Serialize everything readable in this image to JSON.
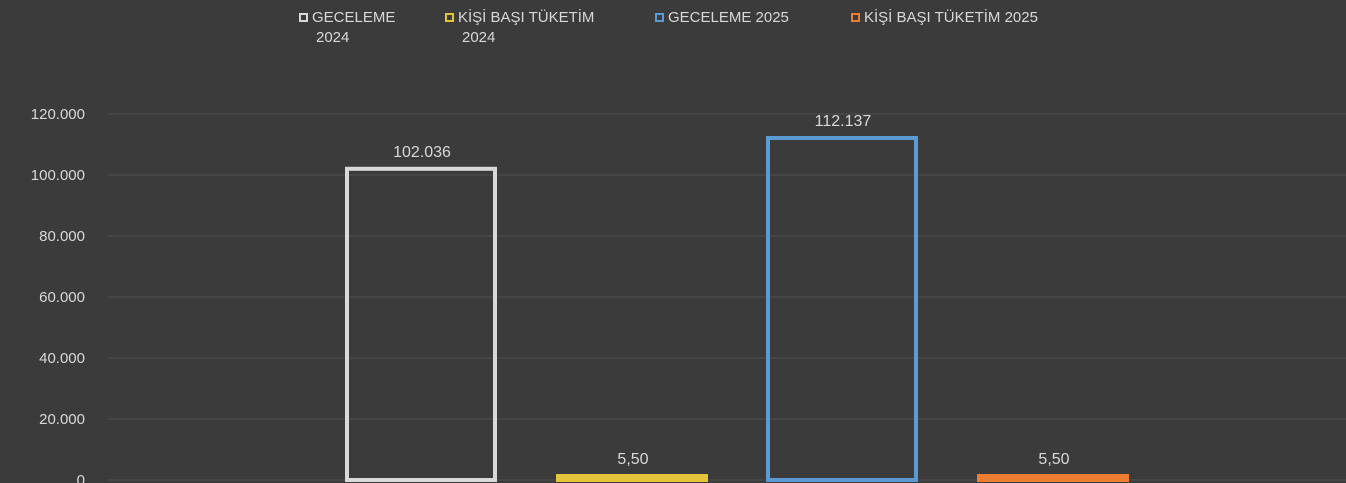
{
  "chart_data": {
    "type": "bar",
    "title": "",
    "xlabel": "",
    "ylabel": "",
    "ylim": [
      0,
      120000
    ],
    "y_ticks": [
      0,
      20000,
      40000,
      60000,
      80000,
      100000,
      120000
    ],
    "y_tick_labels": [
      "0",
      "20.000",
      "40.000",
      "60.000",
      "80.000",
      "100.000",
      "120.000"
    ],
    "grid": true,
    "legend_position": "top",
    "series": [
      {
        "name": "GECELEME 2024",
        "value": 102036,
        "label": "102.036",
        "color": "#d9d9d9"
      },
      {
        "name": "KİŞİ BAŞI TÜKETİM 2024",
        "value": 5.5,
        "label": "5,50",
        "color": "#e5c33a"
      },
      {
        "name": "GECELEME 2025",
        "value": 112137,
        "label": "112.137",
        "color": "#5b9bd5"
      },
      {
        "name": "KİŞİ BAŞI TÜKETİM 2025",
        "value": 5.5,
        "label": "5,50",
        "color": "#ed7d31"
      }
    ]
  },
  "legend": {
    "items": [
      {
        "line1": "GECELEME",
        "line2": "2024",
        "color": "#d9d9d9"
      },
      {
        "line1": "KİŞİ BAŞI TÜKETİM",
        "line2": "2024",
        "color": "#e5c33a"
      },
      {
        "line1": "GECELEME 2025",
        "line2": "",
        "color": "#5b9bd5"
      },
      {
        "line1": "KİŞİ BAŞI TÜKETİM 2025",
        "line2": "",
        "color": "#ed7d31"
      }
    ]
  }
}
